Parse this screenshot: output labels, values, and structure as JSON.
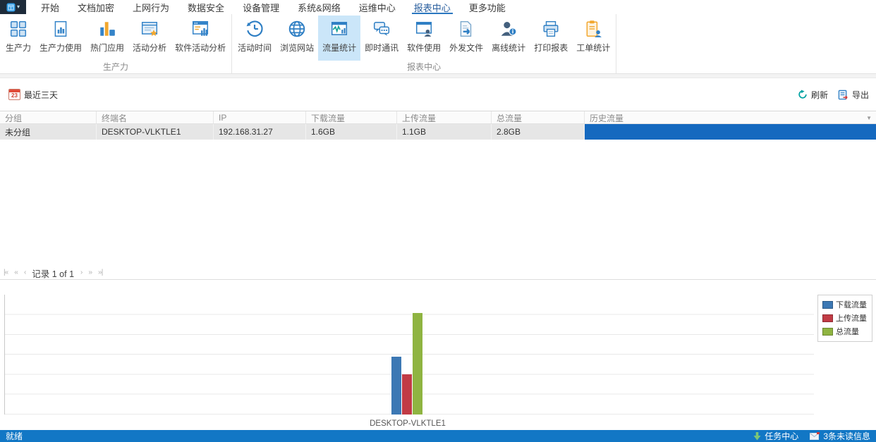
{
  "menu": {
    "tabs": [
      {
        "label": "开始"
      },
      {
        "label": "文档加密"
      },
      {
        "label": "上网行为"
      },
      {
        "label": "数据安全"
      },
      {
        "label": "设备管理"
      },
      {
        "label": "系统&网络"
      },
      {
        "label": "运维中心"
      },
      {
        "label": "报表中心",
        "active": true
      },
      {
        "label": "更多功能"
      }
    ]
  },
  "ribbon": {
    "groups": [
      {
        "label": "生产力",
        "items": [
          {
            "label": "生产力"
          },
          {
            "label": "生产力使用"
          },
          {
            "label": "热门应用"
          },
          {
            "label": "活动分析"
          },
          {
            "label": "软件活动分析"
          }
        ]
      },
      {
        "label": "报表中心",
        "items": [
          {
            "label": "活动时间"
          },
          {
            "label": "浏览网站"
          },
          {
            "label": "流量统计",
            "active": true
          },
          {
            "label": "即时通讯"
          },
          {
            "label": "软件使用"
          },
          {
            "label": "外发文件"
          },
          {
            "label": "离线统计"
          },
          {
            "label": "打印报表"
          },
          {
            "label": "工单统计"
          }
        ]
      }
    ]
  },
  "toolbar": {
    "date_filter": "最近三天",
    "refresh": "刷新",
    "export": "导出"
  },
  "icons": {
    "calendar_day": "23",
    "app_caret": "▾",
    "column_menu": "▼",
    "pager_first": "|‹‹",
    "pager_fastprev": "‹‹",
    "pager_prev": "‹",
    "pager_next": "›",
    "pager_fastnext": "››",
    "pager_last": "››|"
  },
  "table": {
    "columns": [
      "分组",
      "终端名",
      "IP",
      "下载流量",
      "上传流量",
      "总流量",
      "历史流量"
    ],
    "rows": [
      {
        "group": "未分组",
        "terminal": "DESKTOP-VLKTLE1",
        "ip": "192.168.31.27",
        "download": "1.6GB",
        "upload": "1.1GB",
        "total": "2.8GB",
        "history_percent": 100
      }
    ]
  },
  "pagination": {
    "label": "记录 1 of 1"
  },
  "chart_data": {
    "type": "bar",
    "categories": [
      "DESKTOP-VLKTLE1"
    ],
    "series": [
      {
        "name": "下载流量",
        "values": [
          1.6
        ],
        "color": "#3c78b4"
      },
      {
        "name": "上传流量",
        "values": [
          1.1
        ],
        "color": "#c13b45"
      },
      {
        "name": "总流量",
        "values": [
          2.8
        ],
        "color": "#8fb441"
      }
    ],
    "unit": "GB",
    "xlabel": "",
    "ylabel": "",
    "ylim": [
      0,
      3.3
    ],
    "grid": true,
    "legend_position": "top-right"
  },
  "status_bar": {
    "ready": "就绪",
    "task_center": "任务中心",
    "unread": "3条未读信息"
  },
  "colors": {
    "accent": "#1277c5",
    "history_bar": "#1569bf",
    "tab_underline": "#2b77c0",
    "ribbon_selected": "#cbe6f9"
  }
}
